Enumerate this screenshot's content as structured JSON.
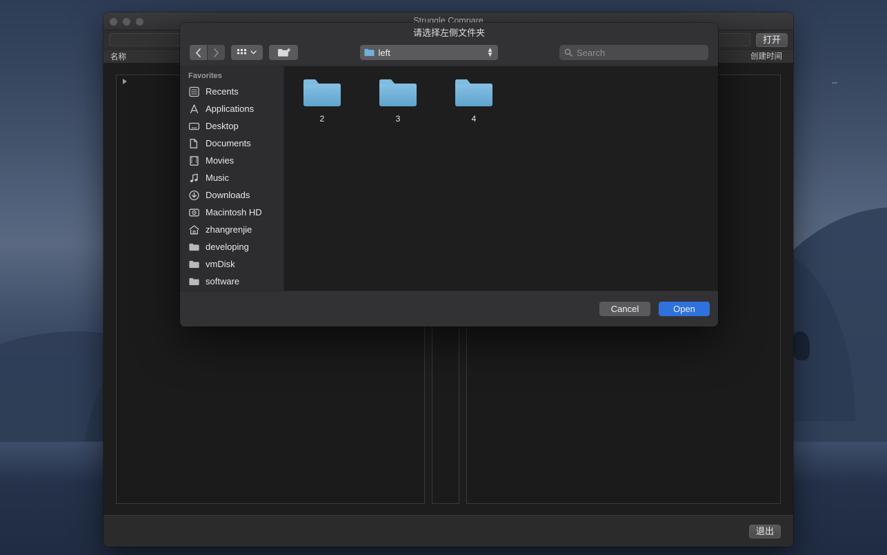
{
  "app_window": {
    "title": "Struggle Compare",
    "traffic_lights": [
      "close-button",
      "minimize-button",
      "zoom-button"
    ],
    "toolbar": {
      "path_value": "",
      "path_placeholder": "",
      "open_label": "打开"
    },
    "columns": {
      "name": "名称",
      "created": "创建时间"
    },
    "row": {
      "disclosure": "collapsed",
      "created_value": "--"
    },
    "footer": {
      "quit_label": "退出"
    }
  },
  "sheet": {
    "title": "请选择左侧文件夹",
    "toolbar": {
      "back_label": "‹",
      "forward_label": "›",
      "view_icon": "grid-view-icon",
      "view_chevron": "⌄",
      "new_folder_icon": "new-folder-icon"
    },
    "path_popup": {
      "label": "left",
      "icon": "folder-icon",
      "stepper": "updown-stepper-icon"
    },
    "search": {
      "icon": "search-icon",
      "placeholder": "Search",
      "value": ""
    },
    "sidebar": {
      "header": "Favorites",
      "items": [
        {
          "label": "Recents",
          "icon": "recents-icon"
        },
        {
          "label": "Applications",
          "icon": "applications-icon"
        },
        {
          "label": "Desktop",
          "icon": "desktop-icon"
        },
        {
          "label": "Documents",
          "icon": "documents-icon"
        },
        {
          "label": "Movies",
          "icon": "movies-icon"
        },
        {
          "label": "Music",
          "icon": "music-icon"
        },
        {
          "label": "Downloads",
          "icon": "downloads-icon"
        },
        {
          "label": "Macintosh HD",
          "icon": "harddisk-icon"
        },
        {
          "label": "zhangrenjie",
          "icon": "home-icon"
        },
        {
          "label": "developing",
          "icon": "folder-icon"
        },
        {
          "label": "vmDisk",
          "icon": "folder-icon"
        },
        {
          "label": "software",
          "icon": "folder-icon"
        }
      ]
    },
    "files": [
      {
        "label": "2",
        "icon": "folder-icon"
      },
      {
        "label": "3",
        "icon": "folder-icon"
      },
      {
        "label": "4",
        "icon": "folder-icon"
      }
    ],
    "footer": {
      "cancel_label": "Cancel",
      "open_label": "Open"
    }
  },
  "colors": {
    "accent_blue": "#2f72dd",
    "folder_blue": "#6fb3dd",
    "sheet_bg": "#323234",
    "sidebar_bg": "#2d2d2f",
    "file_area_bg": "#1e1e1f",
    "window_bg": "#2b2b2b"
  }
}
